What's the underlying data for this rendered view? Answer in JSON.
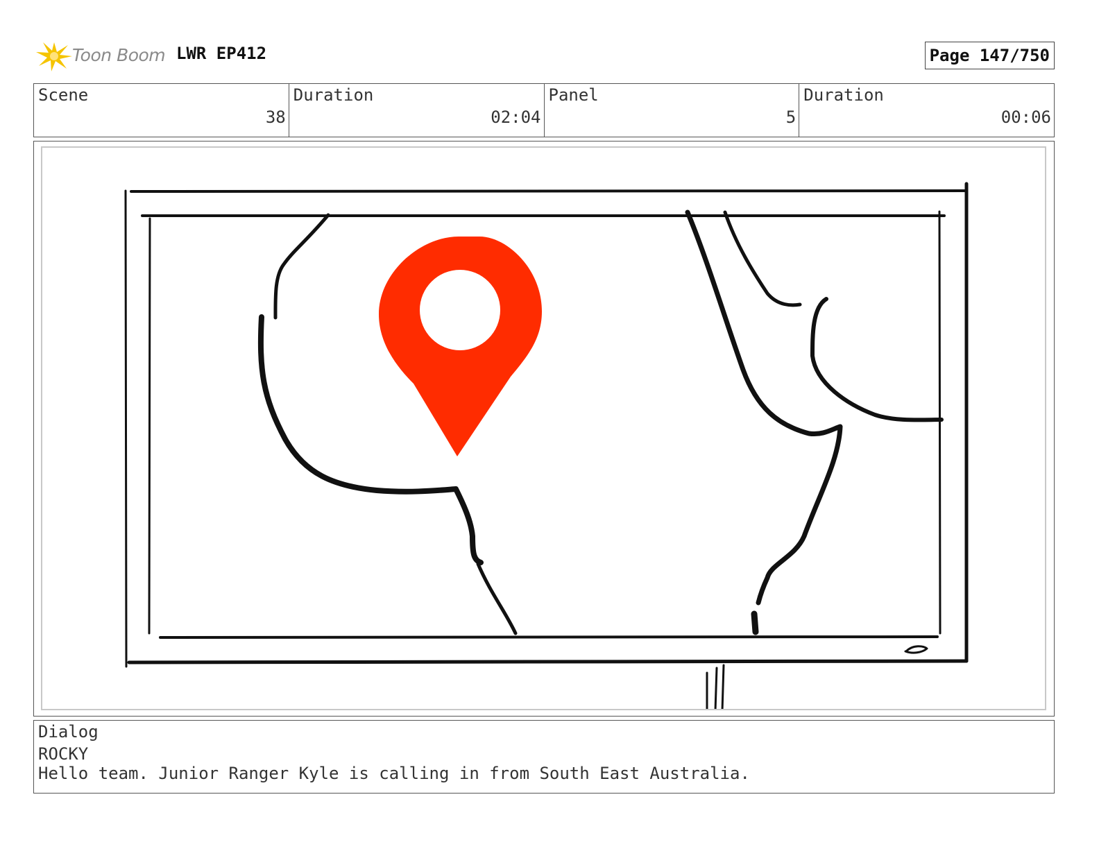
{
  "header": {
    "logo_text": "Toon Boom",
    "project": "LWR EP412",
    "page": "Page 147/750"
  },
  "info": {
    "scene_label": "Scene",
    "scene_value": "38",
    "scene_duration_label": "Duration",
    "scene_duration_value": "02:04",
    "panel_label": "Panel",
    "panel_value": "5",
    "panel_duration_label": "Duration",
    "panel_duration_value": "00:06"
  },
  "panel": {
    "image": "sketch-tv-screen-map-with-location-pin",
    "pin_color": "#ff2c00",
    "line_color": "#111111"
  },
  "dialog": {
    "label": "Dialog",
    "character": "ROCKY",
    "line": "Hello team. Junior Ranger Kyle is calling in from South East Australia."
  }
}
